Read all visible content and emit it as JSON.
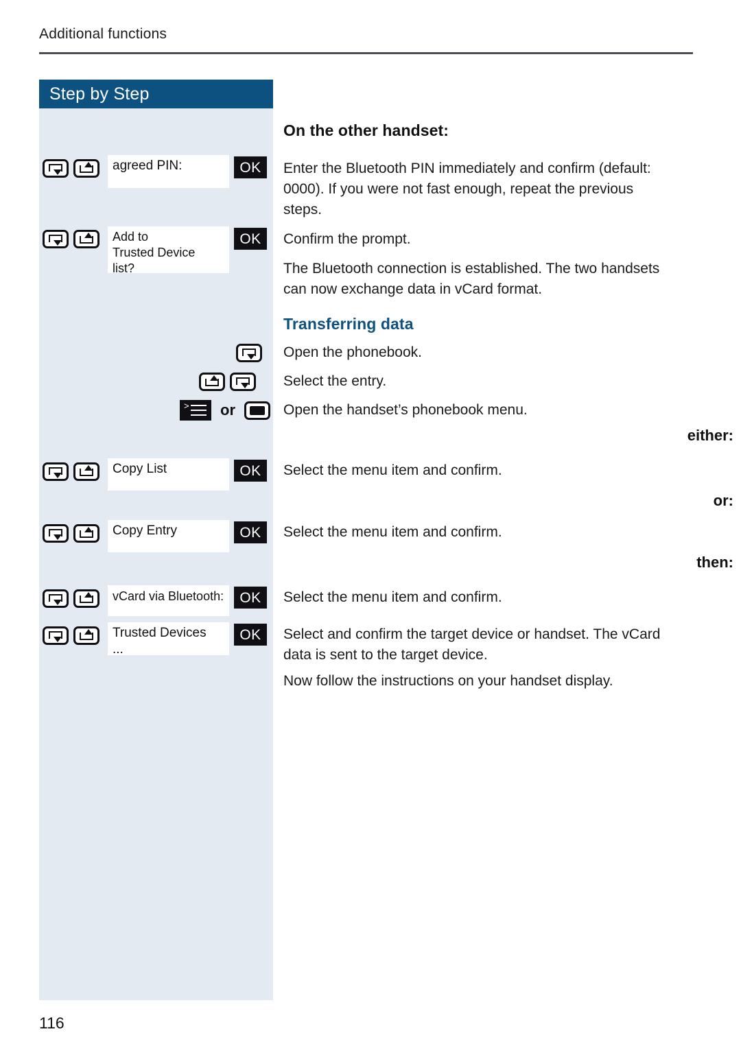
{
  "page": {
    "running_head": "Additional functions",
    "folio": "116",
    "accent_color": "#0d5180",
    "panel_color": "#e4eaf1"
  },
  "sidebar": {
    "header_label": "Step by Step",
    "rows": [
      {
        "id": "agreed-pin",
        "keys": [
          "key-down",
          "key-up"
        ],
        "display": "agreed PIN:",
        "ok_label": "OK"
      },
      {
        "id": "add-to-trusted-device-list",
        "keys": [
          "key-down",
          "key-up"
        ],
        "display": "Add to\nTrusted Device\nlist?",
        "ok_label": "OK"
      },
      {
        "id": "open-phonebook",
        "keys": [
          "key-down"
        ]
      },
      {
        "id": "select-entry",
        "keys": [
          "key-up",
          "key-down"
        ]
      },
      {
        "id": "open-phonebook-menu",
        "keys": [
          "key-menu",
          "key-solid"
        ],
        "or_word": "or"
      },
      {
        "id": "copy-list",
        "keys": [
          "key-down",
          "key-up"
        ],
        "display": "Copy List",
        "ok_label": "OK"
      },
      {
        "id": "copy-entry",
        "keys": [
          "key-down",
          "key-up"
        ],
        "display": "Copy Entry",
        "ok_label": "OK"
      },
      {
        "id": "vcard-via-bluetooth",
        "keys": [
          "key-down",
          "key-up"
        ],
        "display": "vCard via Bluetooth:",
        "ok_label": "OK"
      },
      {
        "id": "trusted-devices",
        "keys": [
          "key-down",
          "key-up"
        ],
        "display": "Trusted Devices\n...",
        "ok_label": "OK"
      }
    ],
    "labels": {
      "either": "either:",
      "or": "or:",
      "then": "then:"
    }
  },
  "main": {
    "heading_other_handset": "On the other handset:",
    "para_enter_pin": "Enter the Bluetooth PIN immediately and confirm (default: 0000). If you were not fast enough, repeat the previous steps.",
    "para_confirm_prompt": "Confirm the prompt.",
    "para_connection_established": "The Bluetooth connection is established. The two handsets can now exchange data in vCard format.",
    "heading_transferring_data": "Transferring data",
    "para_open_phonebook": "Open the phonebook.",
    "para_select_entry": "Select the entry.",
    "para_open_phonebook_menu": "Open the handset’s phonebook menu.",
    "para_select_confirm_1": "Select the menu item and confirm.",
    "para_select_confirm_2": "Select the menu item and confirm.",
    "para_select_confirm_3": "Select the menu item and confirm.",
    "para_select_target": "Select and confirm the target device or handset. The vCard data is sent to the target device.",
    "para_follow_instructions": "Now follow the instructions on your handset display."
  }
}
